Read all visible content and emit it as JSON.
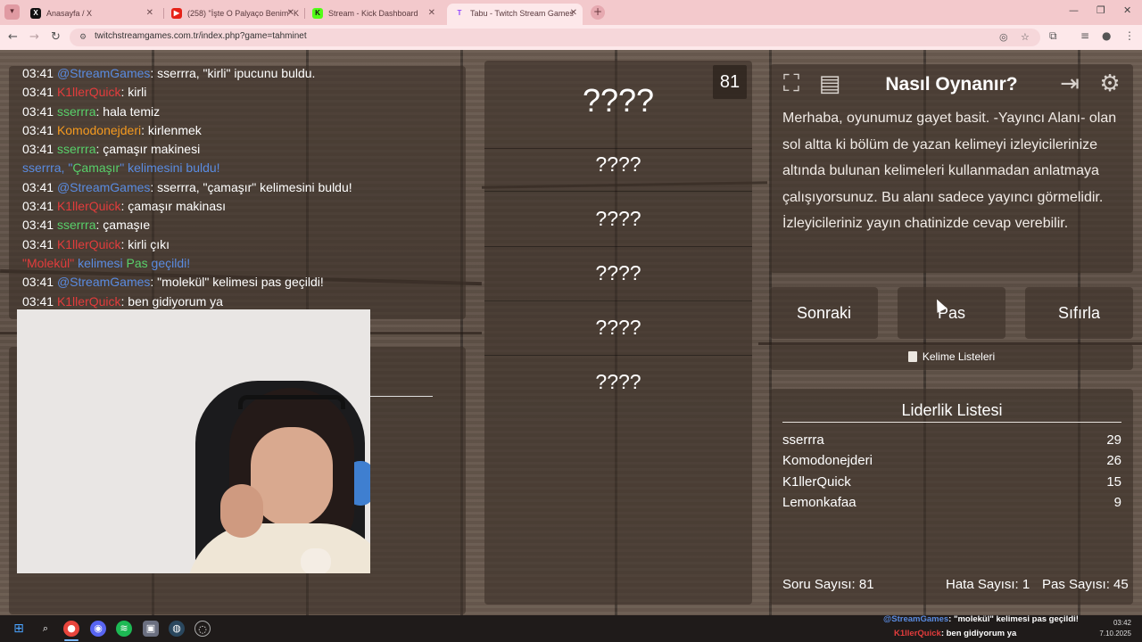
{
  "browser": {
    "tabs": [
      {
        "label": "Anasayfa / X",
        "favicon": "x-logo-icon",
        "active": false
      },
      {
        "label": "(258) \"İşte O Palyaço Benim\" K",
        "favicon": "youtube-icon",
        "active": false
      },
      {
        "label": "Stream - Kick Dashboard",
        "favicon": "kick-icon",
        "active": false
      },
      {
        "label": "Tabu - Twitch Stream Games",
        "favicon": "twitch-icon",
        "active": true
      }
    ],
    "url": "twitchstreamgames.com.tr/index.php?game=tahminet",
    "colors": {
      "tabbar": "#f3c9cc",
      "toolbar": "#fde8ea"
    }
  },
  "chat": {
    "lines": [
      {
        "time": "03:41",
        "user": "@StreamGames",
        "user_color": "blue",
        "text": ": sserrra, \"kirli\" ipucunu buldu."
      },
      {
        "time": "03:41",
        "user": "K1llerQuick",
        "user_color": "red",
        "text": ": kirli"
      },
      {
        "time": "03:41",
        "user": "sserrra",
        "user_color": "green",
        "text": ": hala temiz"
      },
      {
        "time": "03:41",
        "user": "Komodonejderi",
        "user_color": "orange",
        "text": ": kirlenmek"
      },
      {
        "time": "03:41",
        "user": "sserrra",
        "user_color": "green",
        "text": ": çamaşır makinesi"
      },
      {
        "system": true,
        "parts": [
          {
            "text": "sserrra, \"",
            "color": "blue"
          },
          {
            "text": "Çamaşır",
            "color": "green"
          },
          {
            "text": "\" kelimesini buldu!",
            "color": "blue"
          }
        ]
      },
      {
        "time": "03:41",
        "user": "@StreamGames",
        "user_color": "blue",
        "text": ": sserrra, \"çamaşır\" kelimesini buldu!"
      },
      {
        "time": "03:41",
        "user": "K1llerQuick",
        "user_color": "red",
        "text": ": çamaşır makinası"
      },
      {
        "time": "03:41",
        "user": "sserrra",
        "user_color": "green",
        "text": ": çamaşıe"
      },
      {
        "time": "03:41",
        "user": "K1llerQuick",
        "user_color": "red",
        "text": ": kirli çıkı"
      },
      {
        "system": true,
        "parts": [
          {
            "text": "\"Molekül\"",
            "color": "red"
          },
          {
            "text": " kelimesi ",
            "color": "blue"
          },
          {
            "text": "Pas",
            "color": "green"
          },
          {
            "text": " geçildi!",
            "color": "blue"
          }
        ]
      },
      {
        "time": "03:41",
        "user": "@StreamGames",
        "user_color": "blue",
        "text": ": \"molekül\" kelimesi pas geçildi!"
      },
      {
        "time": "03:41",
        "user": "K1llerQuick",
        "user_color": "red",
        "text": ": ben gidiyorum ya"
      }
    ]
  },
  "game": {
    "counter": "81",
    "main_word": "????",
    "taboo_words": [
      "????",
      "????",
      "????",
      "????",
      "????"
    ]
  },
  "howto": {
    "title": "Nasıl Oynanır?",
    "text": "Merhaba, oyunumuz gayet basit. -Yayıncı Alanı- olan sol altta ki bölüm de yazan kelimeyi izleyicilerinize altında bulunan kelimeleri kullanmadan anlatmaya çalışıyorsunuz. Bu alanı sadece yayıncı görmelidir. İzleyicileriniz yayın chatinizde cevap verebilir.",
    "icons": [
      "fullscreen-icon",
      "notes-icon",
      "exit-icon",
      "settings-gear-icon"
    ]
  },
  "buttons": {
    "next": "Sonraki",
    "pass": "Pas",
    "reset": "Sıfırla",
    "word_lists": "Kelime Listeleri"
  },
  "leaderboard": {
    "title": "Liderlik Listesi",
    "rows": [
      {
        "name": "sserrra",
        "score": "29"
      },
      {
        "name": "Komodonejderi",
        "score": "26"
      },
      {
        "name": "K1llerQuick",
        "score": "15"
      },
      {
        "name": "Lemonkafaa",
        "score": "9"
      }
    ],
    "stats": {
      "questions": "Soru Sayısı: 81",
      "errors": "Hata Sayısı: 1",
      "passes": "Pas Sayısı: 45"
    }
  },
  "taskbar": {
    "overlay": [
      {
        "user": "@StreamGames",
        "text": ": \"molekül\" kelimesi pas geçildi!"
      },
      {
        "user": "K1llerQuick",
        "text": ": ben gidiyorum ya"
      }
    ],
    "time": "03:42",
    "date": "7.10.2025"
  }
}
